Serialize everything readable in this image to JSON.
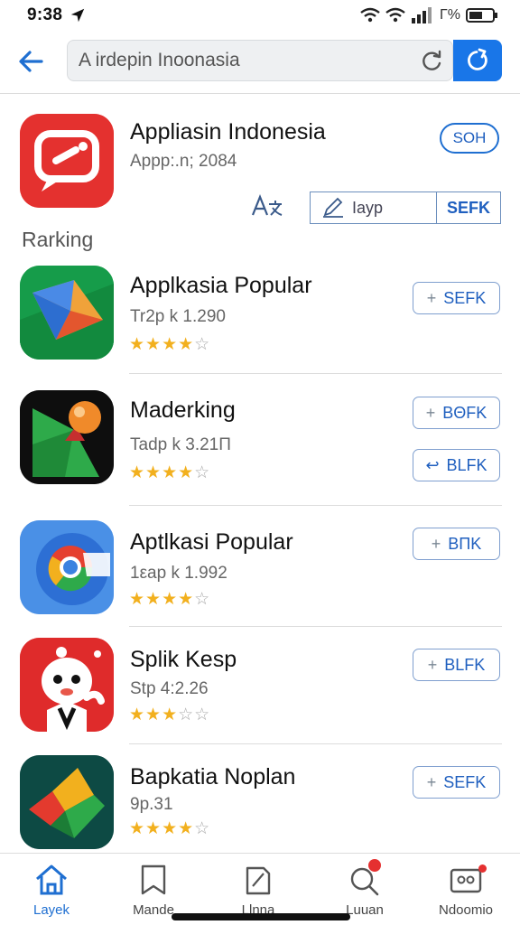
{
  "status": {
    "time": "9:38",
    "battery": "Γ%"
  },
  "search": {
    "query": "A irdepin Inoonasia"
  },
  "featured": {
    "title": "Appliasin Indonesia",
    "subtitle": "Appp:.n; 2084",
    "action_label": "SOH",
    "segment_text": "Iayp",
    "segment_action": "SEFK"
  },
  "section": {
    "label": "Rarking"
  },
  "apps": [
    {
      "title": "Applkasia Popular",
      "meta": "Tr2p k 1.290",
      "rating": 4,
      "button": "SEFK",
      "button_glyph": "+"
    },
    {
      "title": "Maderking",
      "meta": "Tadp k 3.21Π",
      "rating": 4,
      "button": "BΘFK",
      "button_glyph": "+",
      "button2": "BLFK",
      "button2_glyph": "↩"
    },
    {
      "title": "Aptlkasi Popular",
      "meta": "1εap k 1.992",
      "rating": 4,
      "button": "BΠK",
      "button_glyph": "+"
    },
    {
      "title": "Splik Kesp",
      "meta": "Stp 4:2.26",
      "rating": 3,
      "button": "BLFK",
      "button_glyph": "+"
    },
    {
      "title": "Bapkatia Noplan",
      "meta": "9p.31",
      "rating": 4,
      "button": "SEFK",
      "button_glyph": "+"
    }
  ],
  "nav": [
    {
      "label": "Layek",
      "icon": "home-icon",
      "active": true
    },
    {
      "label": "Mande",
      "icon": "bookmark-icon",
      "active": false
    },
    {
      "label": "Llnna",
      "icon": "document-icon",
      "active": false
    },
    {
      "label": "Luuan",
      "icon": "search-icon",
      "active": false
    },
    {
      "label": "Ndoomio",
      "icon": "profile-card-icon",
      "active": false
    }
  ],
  "colors": {
    "accent": "#1976e8",
    "star": "#f2b01e",
    "badge": "#e53030"
  }
}
